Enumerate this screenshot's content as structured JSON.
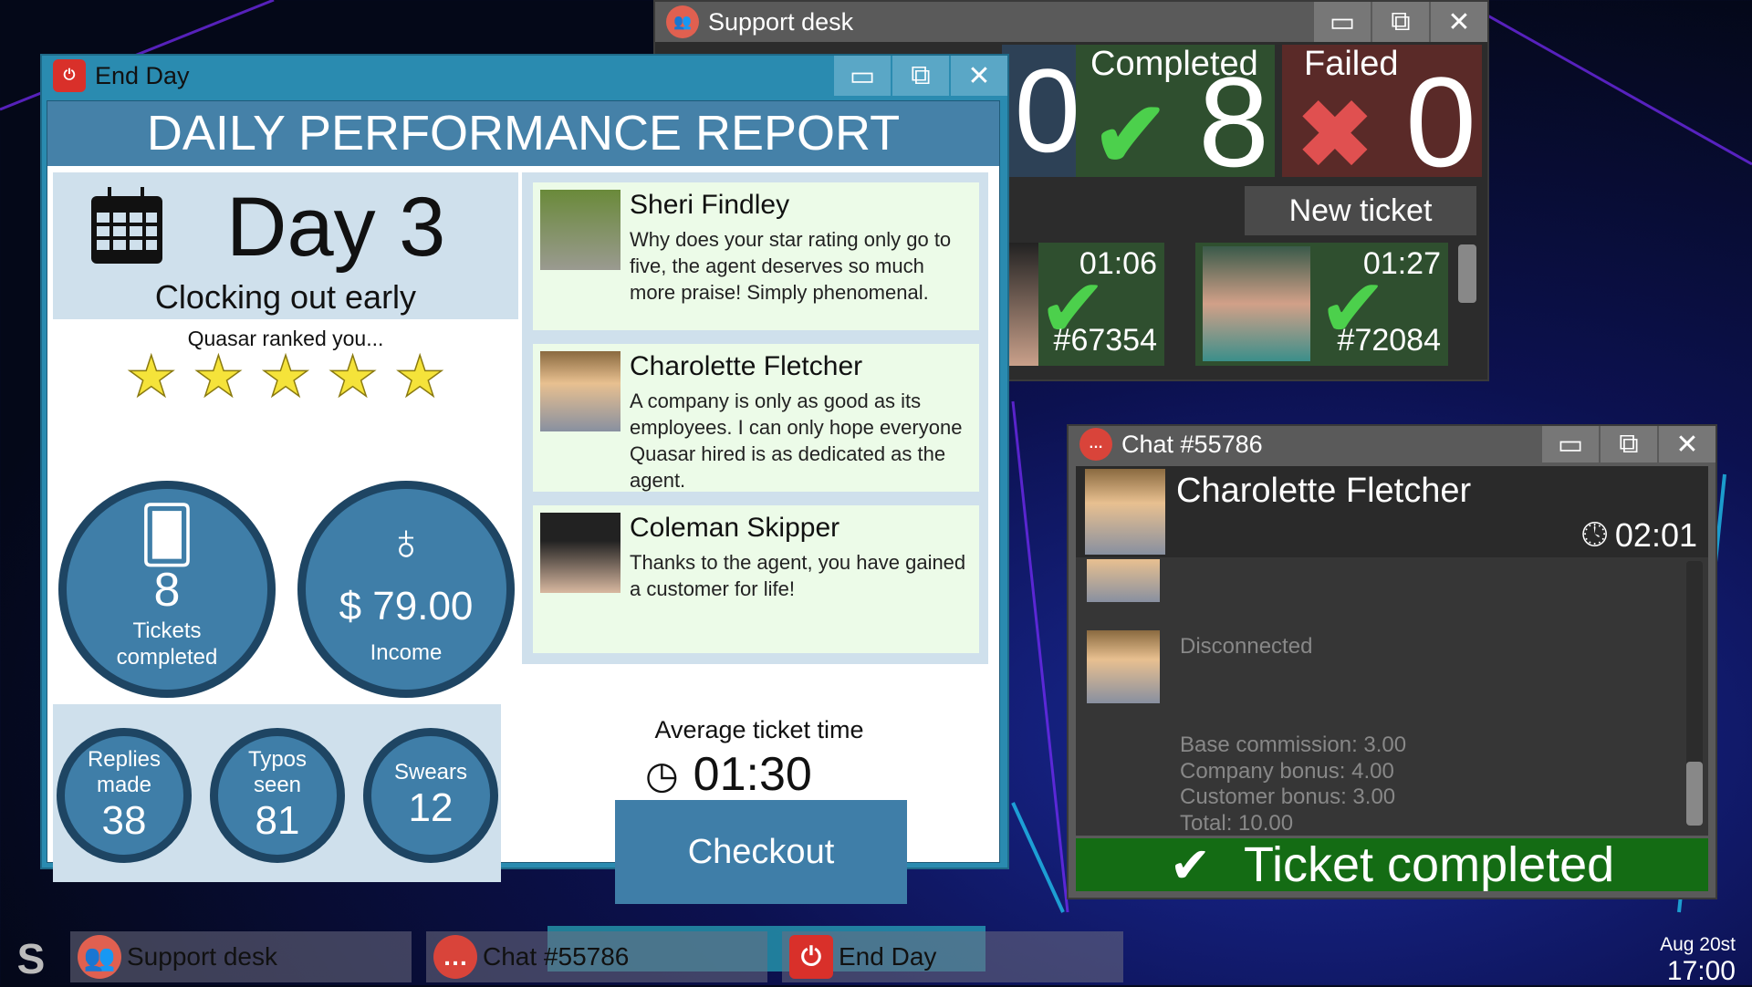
{
  "colors": {
    "accent_blue": "#3f7ea8",
    "title_blue": "#2a8bb0",
    "success_green": "#146c14",
    "failed_red": "#5a2a28",
    "dark_panel": "#333333"
  },
  "support_desk": {
    "title": "Support desk",
    "icon": "support-people-icon",
    "partial_count": "0",
    "completed": {
      "label": "Completed",
      "value": "8",
      "icon": "check-icon"
    },
    "failed": {
      "label": "Failed",
      "value": "0",
      "icon": "cross-icon"
    },
    "new_ticket": "New ticket",
    "tickets": [
      {
        "time": "01:06",
        "id": "#67354",
        "status": "check-icon"
      },
      {
        "time": "01:27",
        "id": "#72084",
        "status": "check-icon"
      }
    ]
  },
  "end_day": {
    "title": "End Day",
    "icon": "power-icon",
    "report_title": "DAILY PERFORMANCE REPORT",
    "day": "Day 3",
    "subtitle": "Clocking out early",
    "ranked": "Quasar ranked you...",
    "stars": 5,
    "stars_max": 5,
    "tickets": {
      "value": "8",
      "label": "Tickets completed"
    },
    "income": {
      "value": "$ 79.00",
      "label": "Income"
    },
    "stats": [
      {
        "label": "Replies made",
        "value": "38"
      },
      {
        "label": "Typos seen",
        "value": "81"
      },
      {
        "label": "Swears",
        "value": "12"
      }
    ],
    "reviews": [
      {
        "name": "Sheri Findley",
        "text": "Why does your star rating only go to five,  the agent deserves so much more praise! Simply phenomenal."
      },
      {
        "name": "Charolette Fletcher",
        "text": "A company is only as good as its employees. I can only hope everyone Quasar hired is as dedicated as  the agent."
      },
      {
        "name": "Coleman Skipper",
        "text": "Thanks to  the agent, you have gained a customer for life!"
      }
    ],
    "avg_label": "Average ticket time",
    "avg_time": "01:30",
    "checkout": "Checkout"
  },
  "chat": {
    "title": "Chat #55786",
    "customer": "Charolette Fletcher",
    "timer": "02:01",
    "messages": [
      "Disconnected"
    ],
    "summary": [
      "Base commission: 3.00",
      "Company bonus: 4.00",
      "Customer bonus: 3.00",
      "Total: 10.00"
    ],
    "status": "Ticket completed"
  },
  "taskbar": {
    "items": [
      "Support desk",
      "Chat #55786",
      "End Day"
    ],
    "date": "Aug 20st",
    "time": "17:00"
  }
}
